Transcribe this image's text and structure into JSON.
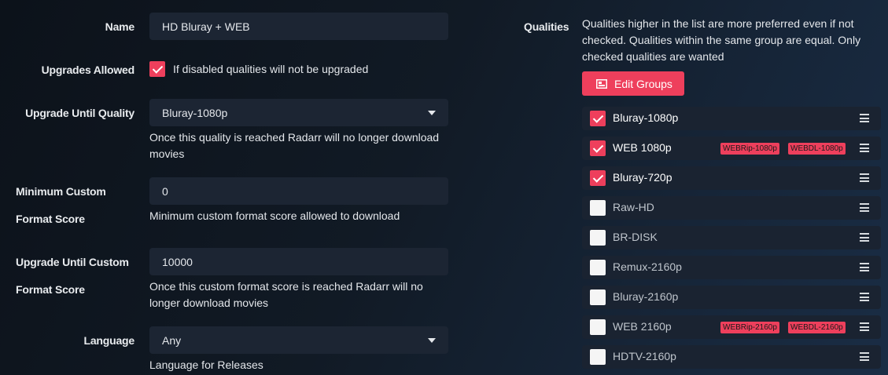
{
  "name": {
    "label": "Name",
    "value": "HD Bluray + WEB"
  },
  "upgrades": {
    "label": "Upgrades Allowed",
    "checked": true,
    "help": "If disabled qualities will not be upgraded"
  },
  "upgrade_until": {
    "label": "Upgrade Until Quality",
    "value": "Bluray-1080p",
    "help": "Once this quality is reached Radarr will no longer download movies"
  },
  "min_custom": {
    "label_line1": "Minimum Custom",
    "label_line2": "Format Score",
    "value": "0",
    "help": "Minimum custom format score allowed to download"
  },
  "upgrade_custom": {
    "label_line1": "Upgrade Until Custom",
    "label_line2": "Format Score",
    "value": "10000",
    "help": "Once this custom format score is reached Radarr will no longer download movies"
  },
  "language": {
    "label": "Language",
    "value": "Any",
    "help": "Language for Releases"
  },
  "qualities": {
    "label": "Qualities",
    "help": "Qualities higher in the list are more preferred even if not checked. Qualities within the same group are equal. Only checked qualities are wanted",
    "edit_groups_label": "Edit Groups",
    "items": [
      {
        "name": "Bluray-1080p",
        "checked": true,
        "tags": []
      },
      {
        "name": "WEB 1080p",
        "checked": true,
        "tags": [
          "WEBRip-1080p",
          "WEBDL-1080p"
        ]
      },
      {
        "name": "Bluray-720p",
        "checked": true,
        "tags": []
      },
      {
        "name": "Raw-HD",
        "checked": false,
        "tags": []
      },
      {
        "name": "BR-DISK",
        "checked": false,
        "tags": []
      },
      {
        "name": "Remux-2160p",
        "checked": false,
        "tags": []
      },
      {
        "name": "Bluray-2160p",
        "checked": false,
        "tags": []
      },
      {
        "name": "WEB 2160p",
        "checked": false,
        "tags": [
          "WEBRip-2160p",
          "WEBDL-2160p"
        ]
      },
      {
        "name": "HDTV-2160p",
        "checked": false,
        "tags": []
      }
    ]
  },
  "colors": {
    "accent": "#ee3f5c",
    "input_bg": "#1c2533",
    "row_bg": "#1a2331"
  }
}
